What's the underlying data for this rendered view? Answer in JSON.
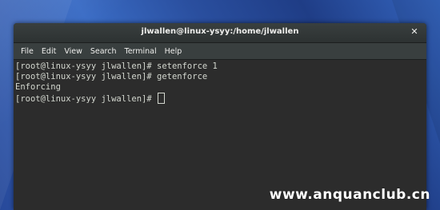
{
  "window": {
    "title": "jlwallen@linux-ysyy:/home/jlwallen",
    "close_icon": "close-icon"
  },
  "menu": {
    "items": [
      "File",
      "Edit",
      "View",
      "Search",
      "Terminal",
      "Help"
    ]
  },
  "terminal": {
    "lines": [
      "[root@linux-ysyy jlwallen]# setenforce 1",
      "[root@linux-ysyy jlwallen]# getenforce",
      "Enforcing",
      "[root@linux-ysyy jlwallen]# "
    ]
  },
  "watermark": {
    "text": "www.anquanclub.cn"
  }
}
